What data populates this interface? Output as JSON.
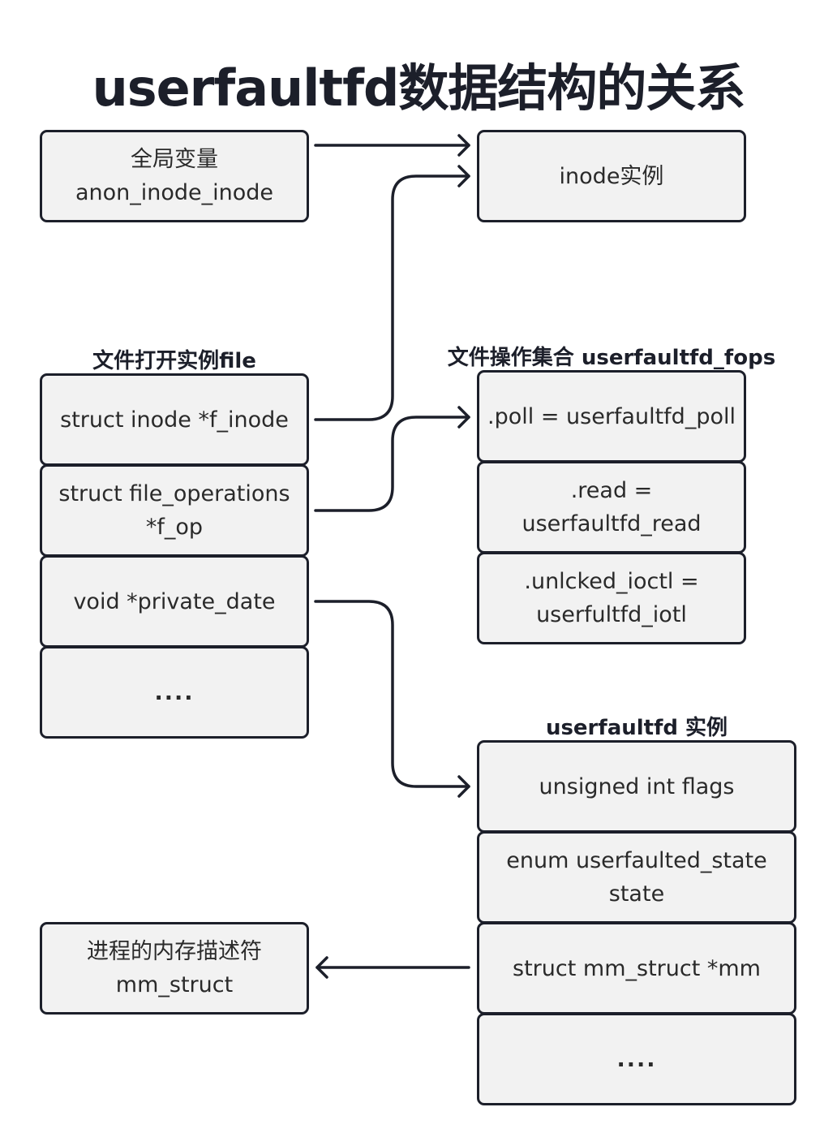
{
  "title": "userfaultfd数据结构的关系",
  "global_var": {
    "text": "全局变量\nanon_inode_inode"
  },
  "inode_instance": {
    "text": "inode实例"
  },
  "file_group": {
    "label": "文件打开实例file",
    "fields": [
      "struct inode *f_inode",
      "struct file_operations\n*f_op",
      "void *private_date",
      "...."
    ]
  },
  "fops_group": {
    "label": "文件操作集合 userfaultfd_fops",
    "fields": [
      ".poll = userfaultfd_poll",
      ".read =\nuserfaultfd_read",
      ".unlcked_ioctl =\nuserfultfd_iotl"
    ]
  },
  "uffd_group": {
    "label": "userfaultfd 实例",
    "fields": [
      "unsigned int flags",
      "enum userfaulted_state\nstate",
      "struct mm_struct *mm",
      "...."
    ]
  },
  "mm_desc": {
    "text": "进程的内存描述符\nmm_struct"
  },
  "colors": {
    "stroke": "#1c1f2a",
    "box_fill": "#f2f2f2"
  }
}
